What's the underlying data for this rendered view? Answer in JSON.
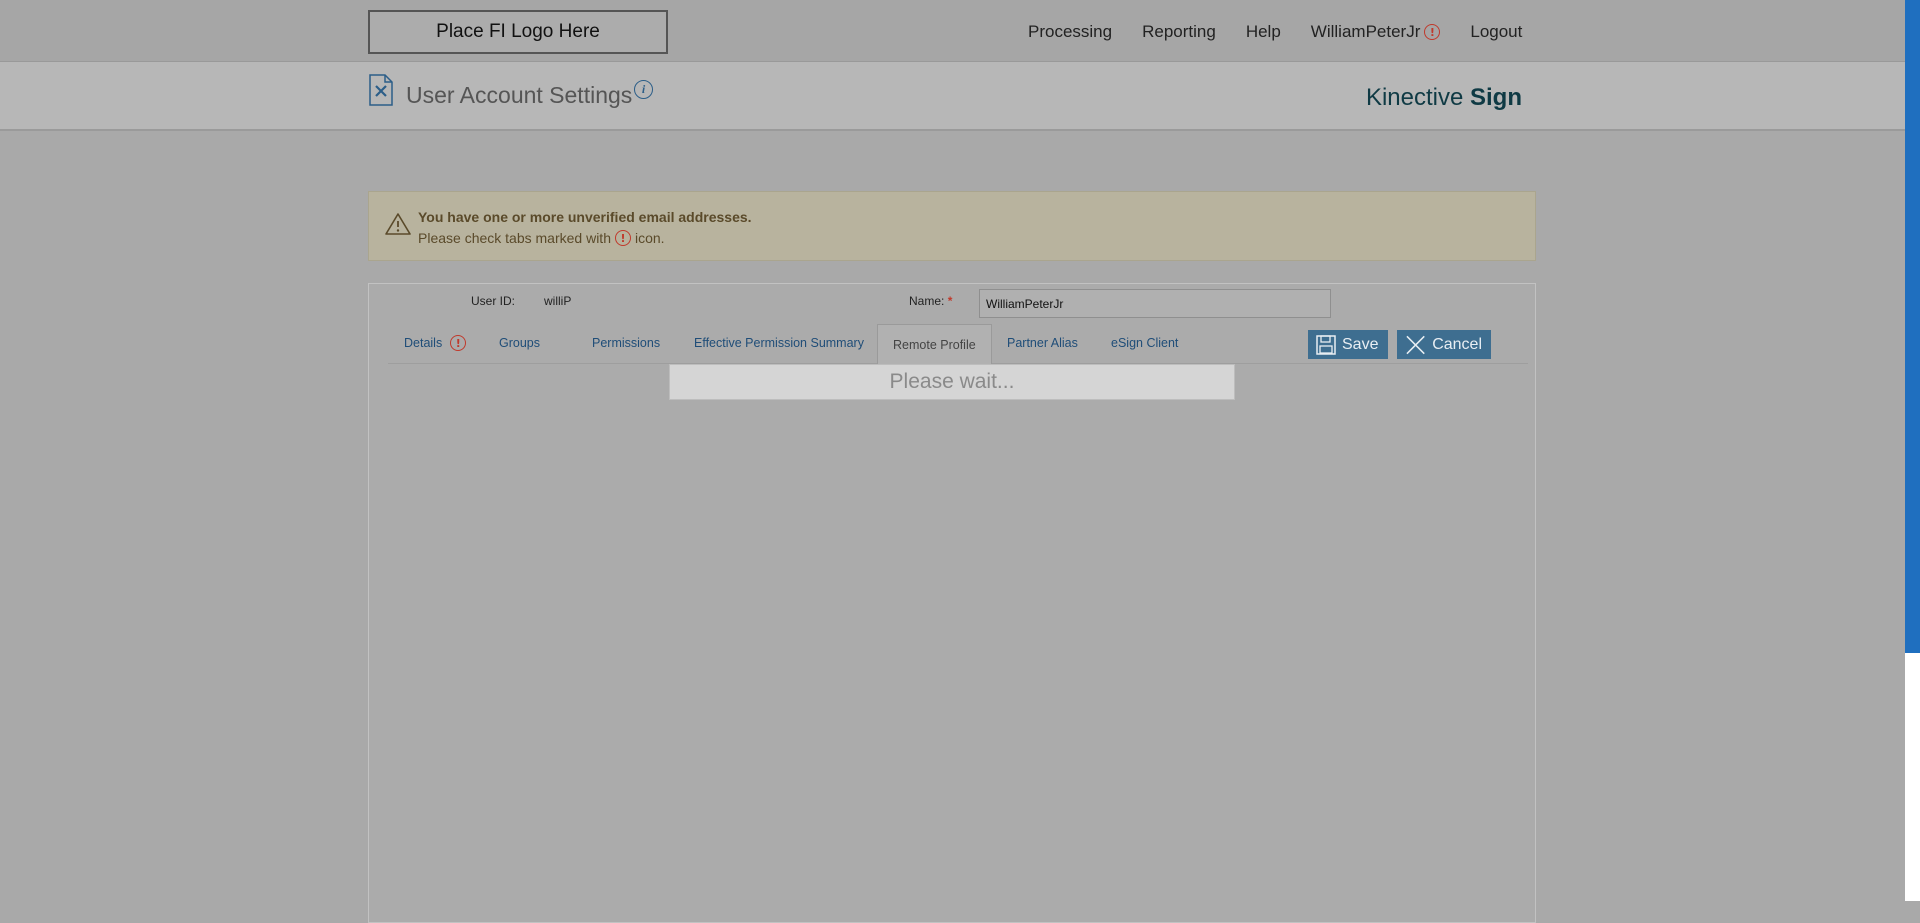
{
  "header": {
    "logo_text": "Place FI Logo Here",
    "nav": [
      {
        "label": "Processing"
      },
      {
        "label": "Reporting"
      },
      {
        "label": "Help"
      },
      {
        "label": "WilliamPeterJr",
        "warning": true
      },
      {
        "label": "Logout"
      }
    ]
  },
  "titlebar": {
    "title": "User Account Settings",
    "info_icon": "i",
    "brand_light": "Kinective",
    "brand_bold": "Sign"
  },
  "alert": {
    "title": "You have one or more unverified email addresses.",
    "text_before": "Please check tabs marked with",
    "text_after": "icon."
  },
  "form": {
    "user_id_label": "User ID:",
    "user_id_value": "williP",
    "name_label": "Name:",
    "name_required": "*",
    "name_value": "WilliamPeterJr"
  },
  "tabs": [
    {
      "label": "Details",
      "warning": true
    },
    {
      "label": "Groups"
    },
    {
      "label": "Permissions"
    },
    {
      "label": "Effective Permission Summary"
    },
    {
      "label": "Remote Profile",
      "active": true
    },
    {
      "label": "Partner Alias"
    },
    {
      "label": "eSign Client"
    }
  ],
  "buttons": {
    "save_label": "Save",
    "cancel_label": "Cancel"
  },
  "loading_text": "Please wait...",
  "warning_glyph": "!",
  "colors": {
    "accent": "#3e6e90",
    "warning": "#c0392b",
    "brand": "#0f3a44",
    "scrollbar": "#1f6fbf"
  }
}
